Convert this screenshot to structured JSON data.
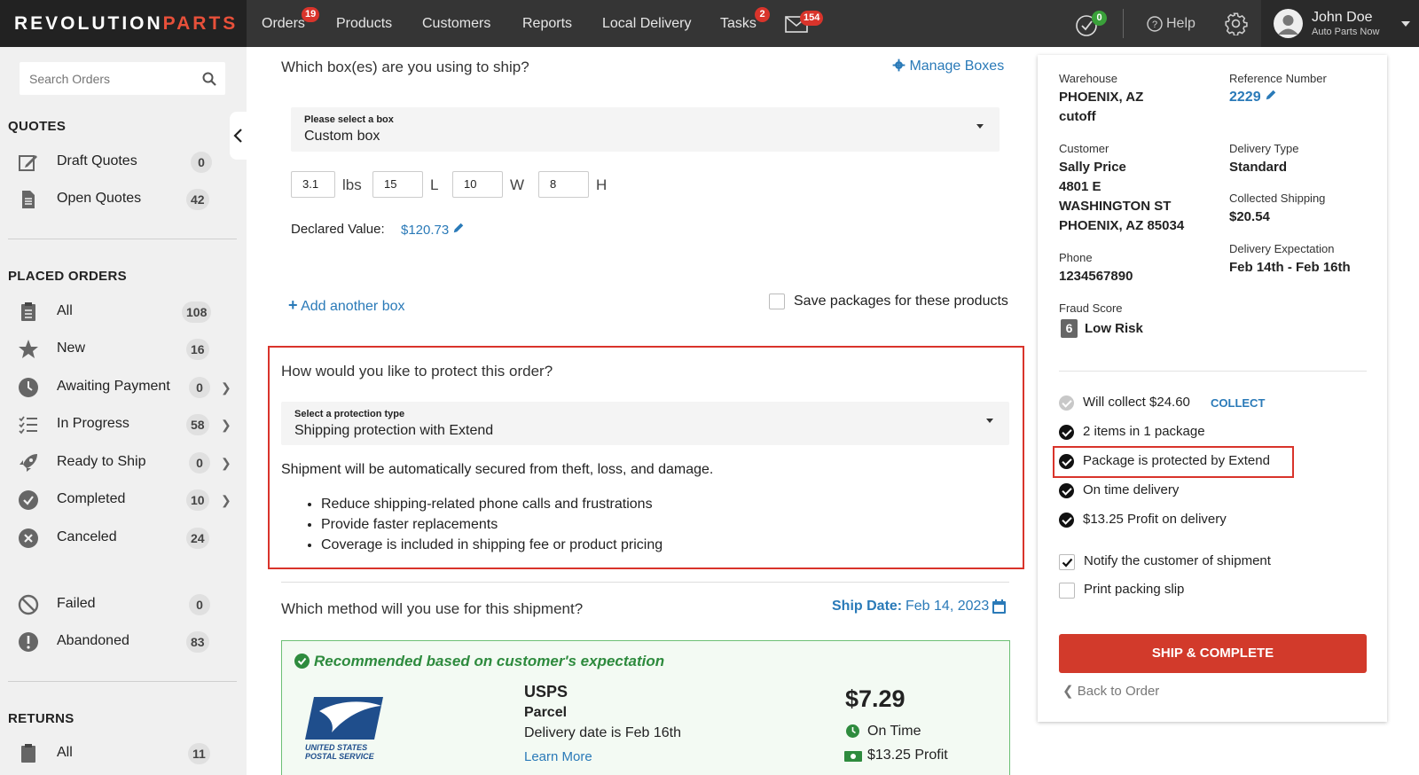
{
  "brand": {
    "word1": "REVOLUTION",
    "word2": "PARTS",
    "accent_color": "#e8503a"
  },
  "nav": {
    "items": [
      {
        "label": "Orders",
        "badge": "19"
      },
      {
        "label": "Products"
      },
      {
        "label": "Customers"
      },
      {
        "label": "Reports"
      },
      {
        "label": "Local Delivery"
      },
      {
        "label": "Tasks",
        "badge": "2"
      }
    ],
    "mail_badge": "154",
    "check_badge": "0",
    "help_label": "Help",
    "user_name": "John Doe",
    "user_company": "Auto Parts Now"
  },
  "sidebar": {
    "search_placeholder": "Search Orders",
    "quotes_title": "QUOTES",
    "quotes": [
      {
        "label": "Draft Quotes",
        "count": "0"
      },
      {
        "label": "Open Quotes",
        "count": "42"
      }
    ],
    "placed_title": "PLACED ORDERS",
    "placed": [
      {
        "label": "All",
        "count": "108"
      },
      {
        "label": "New",
        "count": "16"
      },
      {
        "label": "Awaiting Payment",
        "count": "0"
      },
      {
        "label": "In Progress",
        "count": "58"
      },
      {
        "label": "Ready to Ship",
        "count": "0"
      },
      {
        "label": "Completed",
        "count": "10"
      },
      {
        "label": "Canceled",
        "count": "24"
      },
      {
        "label": "Failed",
        "count": "0"
      },
      {
        "label": "Abandoned",
        "count": "83"
      }
    ],
    "returns_title": "RETURNS",
    "returns": [
      {
        "label": "All",
        "count": "11"
      }
    ]
  },
  "boxes": {
    "question": "Which box(es) are you using to ship?",
    "manage_label": "Manage Boxes",
    "select_label": "Please select a box",
    "select_value": "Custom box",
    "weight": "3.1",
    "weight_unit": "lbs",
    "length": "15",
    "length_unit": "L",
    "width": "10",
    "width_unit": "W",
    "height": "8",
    "height_unit": "H",
    "declared_label": "Declared Value:",
    "declared_value": "$120.73",
    "add_box_label": "Add another box",
    "save_packages_label": "Save packages for these products"
  },
  "protection": {
    "question": "How would you like to protect this order?",
    "select_label": "Select a protection type",
    "select_value": "Shipping protection with Extend",
    "description": "Shipment will be automatically secured from theft, loss, and damage.",
    "bullets": [
      "Reduce shipping-related phone calls and frustrations",
      "Provide faster replacements",
      "Coverage is included in shipping fee or product pricing"
    ],
    "highlight_color": "#d9342b"
  },
  "method": {
    "question": "Which method will you use for this shipment?",
    "ship_date_label": "Ship Date:",
    "ship_date_value": "Feb 14, 2023",
    "recommended_text": "Recommended based on customer's expectation",
    "carrier": "USPS",
    "service": "Parcel",
    "delivery_text": "Delivery date is Feb 16th",
    "learn_more": "Learn More",
    "price": "$7.29",
    "on_time": "On Time",
    "profit": "$13.25 Profit",
    "logo_line1": "UNITED STATES",
    "logo_line2": "POSTAL SERVICE",
    "recommended_color": "#2e8b3e"
  },
  "summary": {
    "warehouse_label": "Warehouse",
    "warehouse_value": "PHOENIX, AZ",
    "warehouse_sub": "cutoff",
    "ref_label": "Reference Number",
    "ref_value": "2229",
    "customer_label": "Customer",
    "customer_lines": [
      "Sally Price",
      "4801 E",
      "WASHINGTON ST",
      "PHOENIX, AZ 85034"
    ],
    "delivery_type_label": "Delivery Type",
    "delivery_type_value": "Standard",
    "collected_label": "Collected Shipping",
    "collected_value": "$20.54",
    "expect_label": "Delivery Expectation",
    "expect_value": "Feb 14th - Feb 16th",
    "phone_label": "Phone",
    "phone_value": "1234567890",
    "fraud_label": "Fraud Score",
    "fraud_score": "6",
    "fraud_text": "Low Risk",
    "collect_text": "Will collect $24.60",
    "collect_link": "COLLECT",
    "checks": [
      "2 items in 1 package",
      "Package is protected by Extend",
      "On time delivery",
      "$13.25 Profit on delivery"
    ],
    "notify_label": "Notify the customer of shipment",
    "print_label": "Print packing slip",
    "ship_button": "SHIP & COMPLETE",
    "back_label": "Back to Order",
    "ship_button_color": "#d23a2b"
  }
}
